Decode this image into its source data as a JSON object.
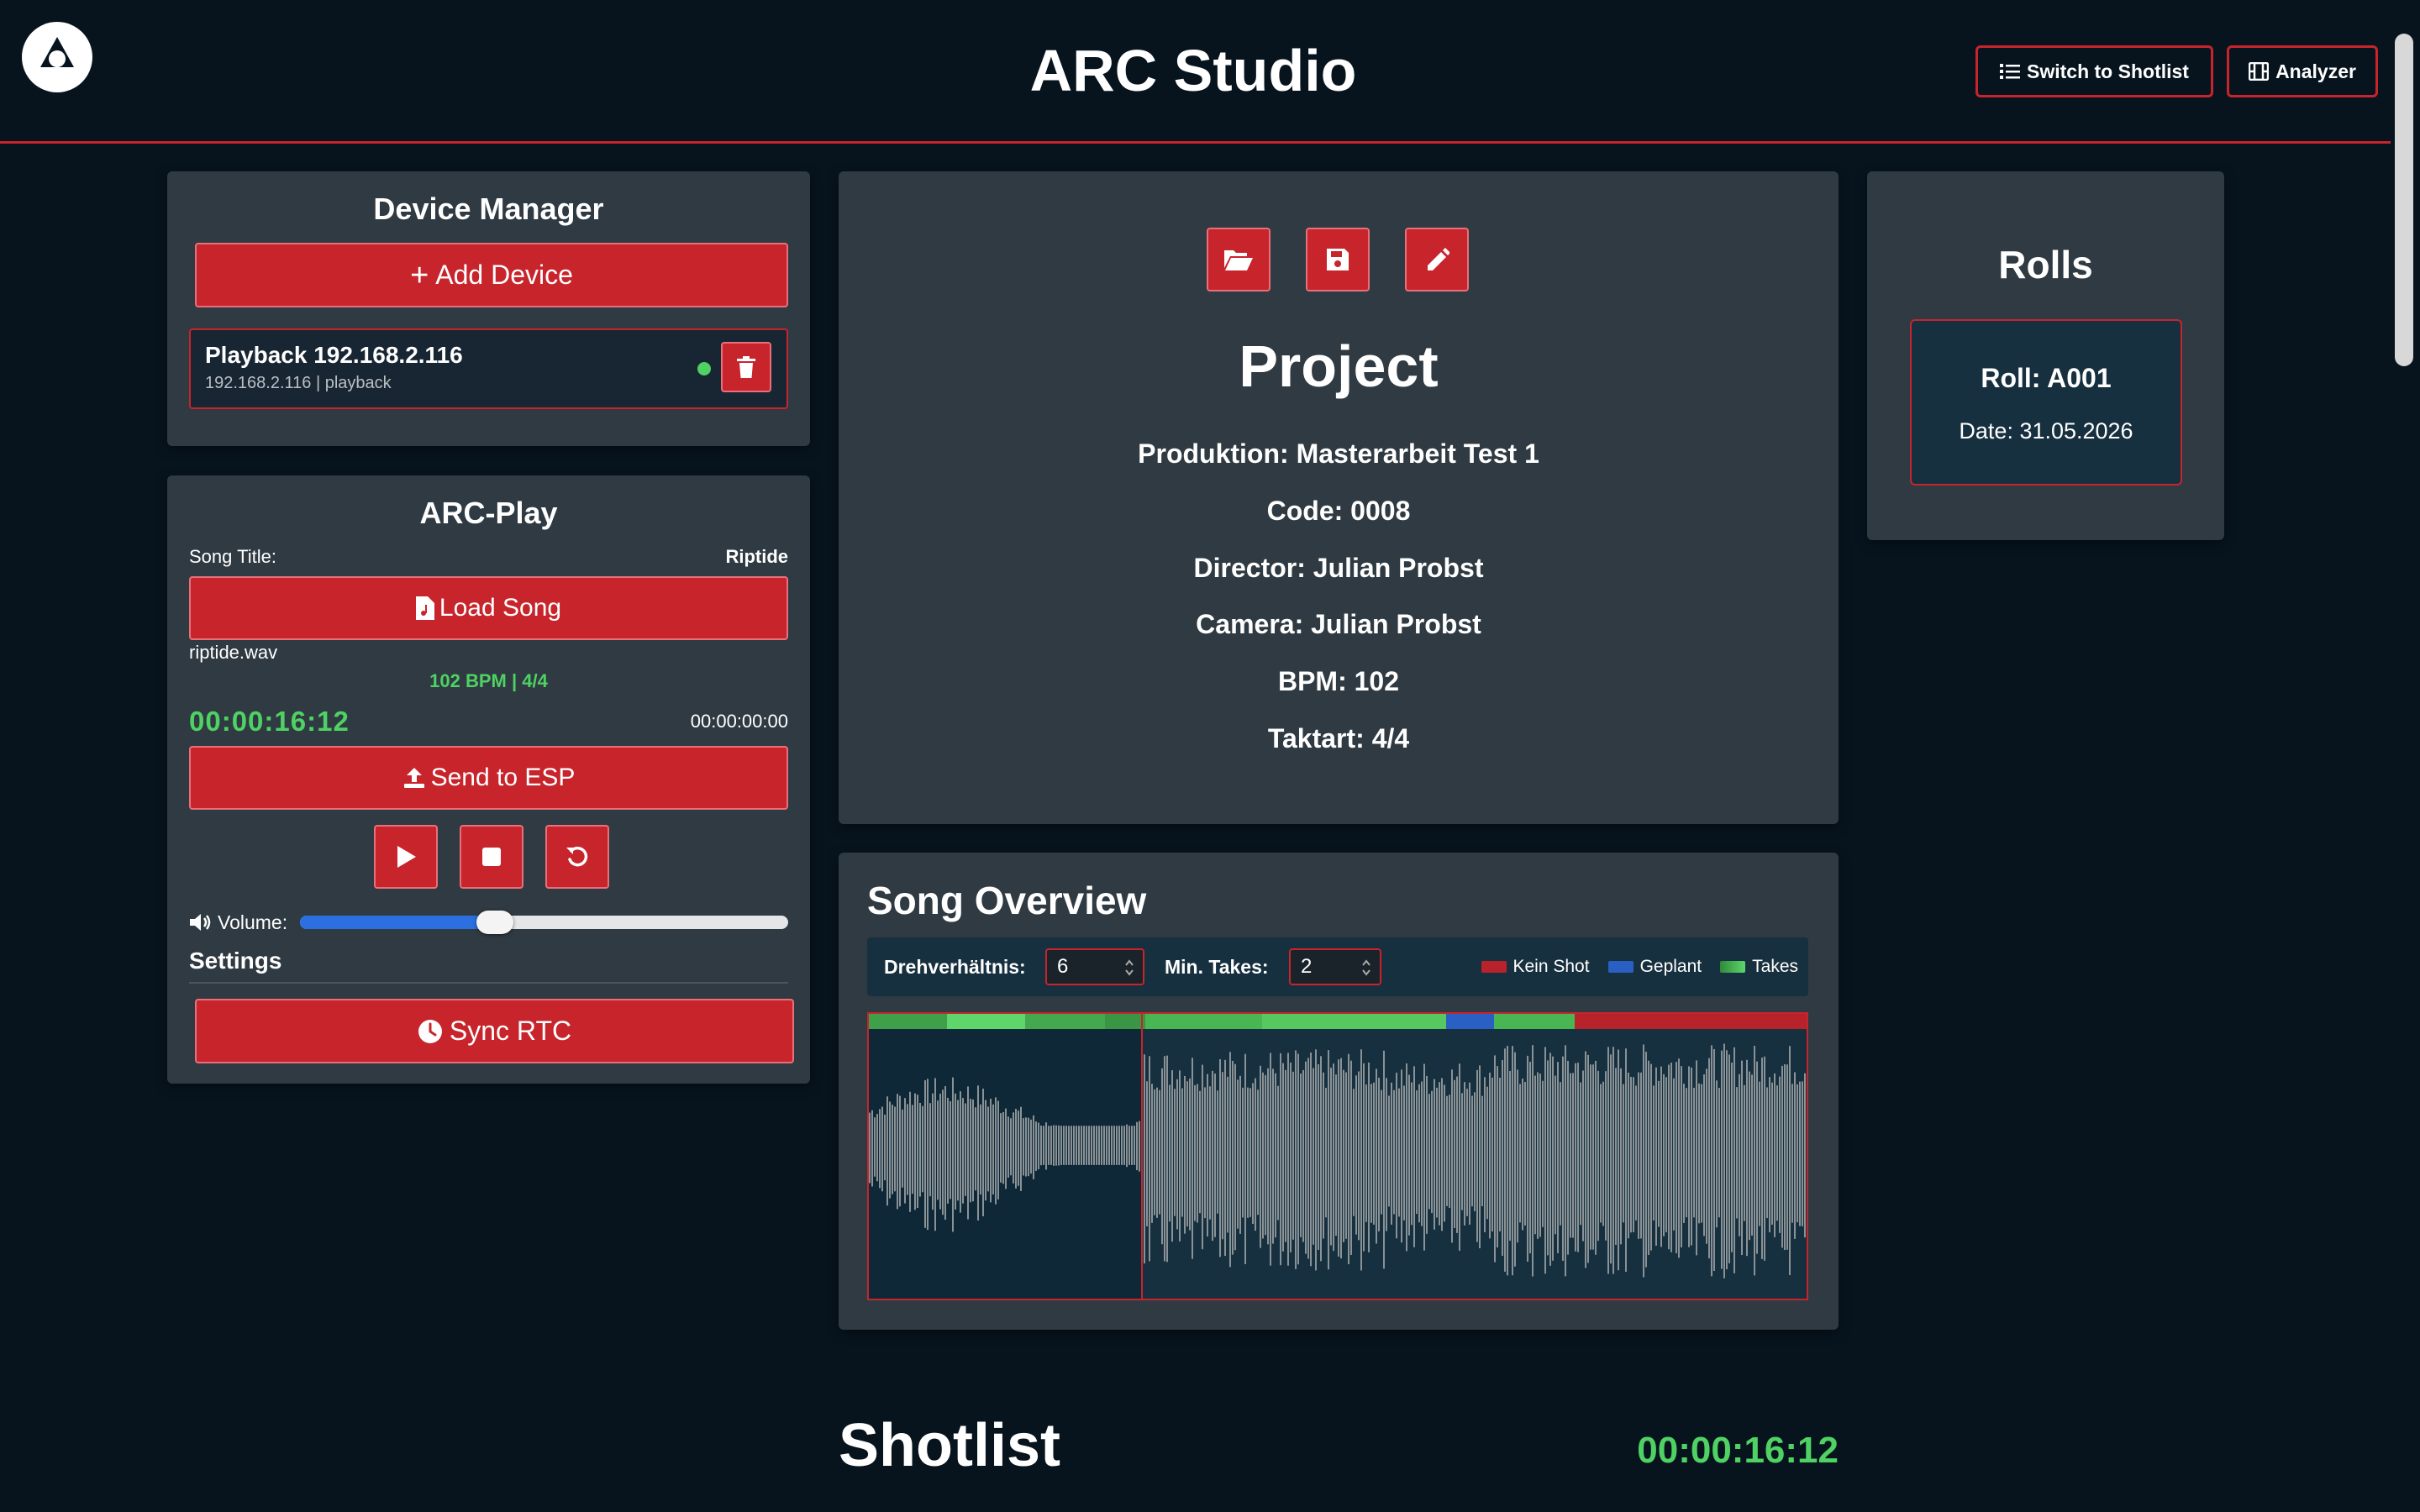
{
  "header": {
    "title": "ARC Studio",
    "shotlist_button": "Switch to Shotlist",
    "analyzer_button": "Analyzer"
  },
  "device_manager": {
    "title": "Device Manager",
    "add_button": "Add Device",
    "devices": [
      {
        "name": "Playback 192.168.2.116",
        "details": "192.168.2.116 | playback",
        "status_color": "#4fd163"
      }
    ]
  },
  "arc_play": {
    "title": "ARC-Play",
    "song_title_label": "Song Title:",
    "song_title_value": "Riptide",
    "load_button": "Load Song",
    "file_name": "riptide.wav",
    "bpm_info": "102 BPM | 4/4",
    "current_time": "00:00:16:12",
    "rtc_time": "00:00:00:00",
    "send_button": "Send to ESP",
    "volume_label": "Volume:",
    "volume_level": 0.4,
    "settings_label": "Settings",
    "sync_button": "Sync RTC"
  },
  "project": {
    "title": "Project",
    "lines": [
      "Produktion: Masterarbeit Test 1",
      "Code: 0008",
      "Director: Julian Probst",
      "Camera: Julian Probst",
      "BPM: 102",
      "Taktart: 4/4"
    ]
  },
  "rolls": {
    "title": "Rolls",
    "items": [
      {
        "roll": "Roll: A001",
        "date": "Date: 31.05.2026"
      }
    ]
  },
  "song_overview": {
    "title": "Song Overview",
    "ratio_label": "Drehverhältnis:",
    "ratio_value": "6",
    "min_takes_label": "Min. Takes:",
    "min_takes_value": "2",
    "legend": [
      {
        "label": "Kein Shot",
        "color": "#b8232b"
      },
      {
        "label": "Geplant",
        "color": "#2a5fc4"
      },
      {
        "label": "Takes",
        "color": "#46b04f"
      }
    ],
    "playhead_fraction": 0.29
  },
  "shotlist": {
    "title": "Shotlist",
    "time": "00:00:16:12"
  },
  "colors": {
    "accent": "#c8242c",
    "background": "#07141e",
    "panel": "#2f3a42",
    "timecode": "#4fd163"
  }
}
